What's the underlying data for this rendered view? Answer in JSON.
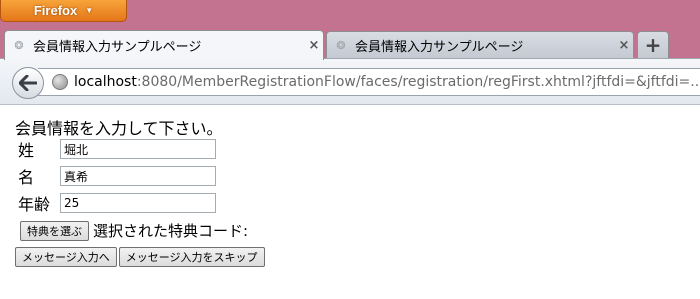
{
  "browser": {
    "app_button_label": "Firefox",
    "tabs": [
      {
        "title": "会員情報入力サンプルページ",
        "active": true
      },
      {
        "title": "会員情報入力サンプルページ",
        "active": false
      }
    ],
    "close_glyph": "×",
    "new_tab_glyph": "+",
    "url_host": "localhost",
    "url_rest": ":8080/MemberRegistrationFlow/faces/registration/regFirst.xhtml?jftfdi=&jftfdi=..."
  },
  "form": {
    "prompt": "会員情報を入力して下さい。",
    "fields": [
      {
        "label": "姓",
        "value": "堀北"
      },
      {
        "label": "名",
        "value": "真希"
      },
      {
        "label": "年齢",
        "value": "25"
      }
    ],
    "select_benefit_button": "特典を選ぶ",
    "selected_benefit_text": "選択された特典コード:",
    "to_message_button": "メッセージ入力へ",
    "skip_message_button": "メッセージ入力をスキップ"
  },
  "colors": {
    "window_background": "#c3738f",
    "firefox_button": "#e4761a",
    "toolbar": "#e3e8ef"
  }
}
